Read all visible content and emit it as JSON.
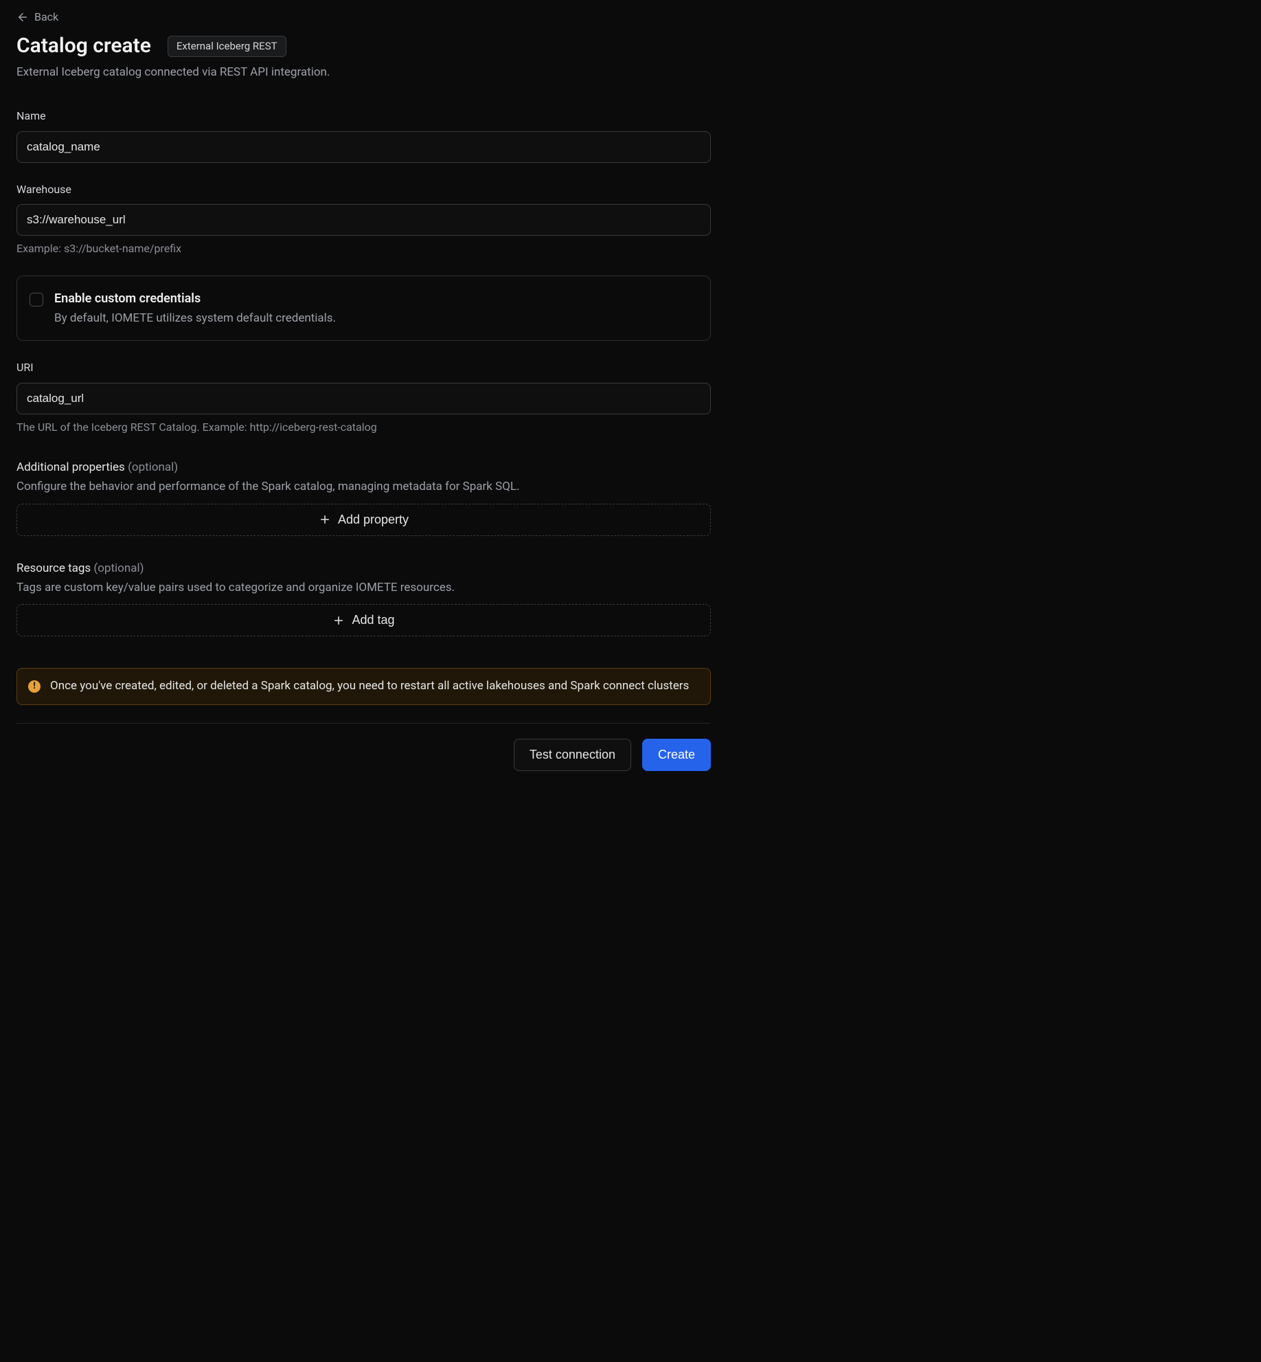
{
  "nav": {
    "back": "Back"
  },
  "header": {
    "title": "Catalog create",
    "badge": "External Iceberg REST",
    "subtitle": "External Iceberg catalog connected via REST API integration."
  },
  "fields": {
    "name": {
      "label": "Name",
      "value": "catalog_name"
    },
    "warehouse": {
      "label": "Warehouse",
      "value": "s3://warehouse_url",
      "help": "Example: s3://bucket-name/prefix"
    },
    "credentials": {
      "title": "Enable custom credentials",
      "description": "By default, IOMETE utilizes system default credentials."
    },
    "uri": {
      "label": "URI",
      "value": "catalog_url",
      "help": "The URL of the Iceberg REST Catalog. Example: http://iceberg-rest-catalog"
    }
  },
  "sections": {
    "properties": {
      "label": "Additional properties",
      "optional": "(optional)",
      "description": "Configure the behavior and performance of the Spark catalog, managing metadata for Spark SQL.",
      "add_button": "Add property"
    },
    "tags": {
      "label": "Resource tags",
      "optional": "(optional)",
      "description": "Tags are custom key/value pairs used to categorize and organize IOMETE resources.",
      "add_button": "Add tag"
    }
  },
  "alert": {
    "text": "Once you've created, edited, or deleted a Spark catalog, you need to restart all active lakehouses and Spark connect clusters"
  },
  "footer": {
    "test_connection": "Test connection",
    "create": "Create"
  }
}
